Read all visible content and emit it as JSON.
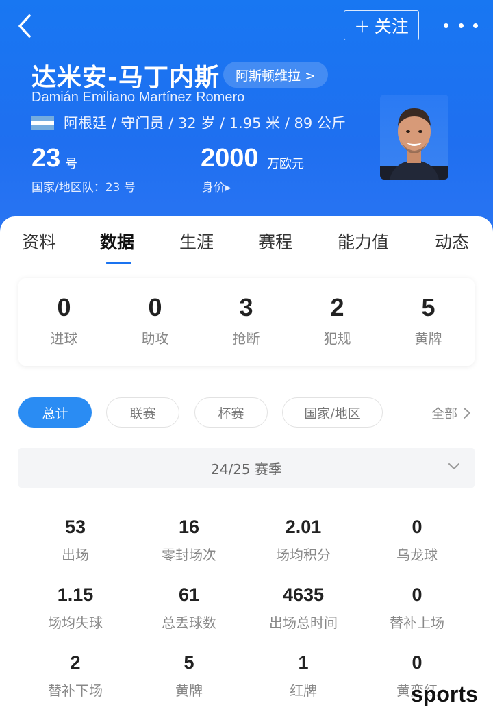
{
  "header": {
    "back_icon": "chevron-left-icon",
    "follow_label": "关注",
    "follow_plus": "+",
    "more_icon": "more-dots-icon",
    "name_cn": "达米安-马丁内斯",
    "club": "阿斯顿维拉 >",
    "name_en": "Damián Emiliano Martínez Romero",
    "nationality_flag": "argentina-flag-icon",
    "info": "阿根廷 / 守门员 / 32 岁 / 1.95 米 / 89 公斤",
    "shirt_number": "23",
    "shirt_unit": "号",
    "national_team": "国家/地区队：23 号",
    "market_value": "2000",
    "market_value_unit": "万欧元",
    "market_value_label": "身价▸",
    "colors": {
      "primary": "#1877f2"
    }
  },
  "tabs": [
    {
      "label": "资料",
      "active": false
    },
    {
      "label": "数据",
      "active": true
    },
    {
      "label": "生涯",
      "active": false
    },
    {
      "label": "赛程",
      "active": false
    },
    {
      "label": "能力值",
      "active": false
    },
    {
      "label": "动态",
      "active": false
    }
  ],
  "summary": [
    {
      "value": "0",
      "label": "进球"
    },
    {
      "value": "0",
      "label": "助攻"
    },
    {
      "value": "3",
      "label": "抢断"
    },
    {
      "value": "2",
      "label": "犯规"
    },
    {
      "value": "5",
      "label": "黄牌"
    }
  ],
  "filters": {
    "chips": [
      "总计",
      "联赛",
      "杯赛",
      "国家/地区"
    ],
    "active_index": 0,
    "all_label": "全部"
  },
  "season": {
    "label": "24/25 赛季"
  },
  "stats": [
    {
      "value": "53",
      "label": "出场"
    },
    {
      "value": "16",
      "label": "零封场次"
    },
    {
      "value": "2.01",
      "label": "场均积分"
    },
    {
      "value": "0",
      "label": "乌龙球"
    },
    {
      "value": "1.15",
      "label": "场均失球"
    },
    {
      "value": "61",
      "label": "总丢球数"
    },
    {
      "value": "4635",
      "label": "出场总时间"
    },
    {
      "value": "0",
      "label": "替补上场"
    },
    {
      "value": "2",
      "label": "替补下场"
    },
    {
      "value": "5",
      "label": "黄牌"
    },
    {
      "value": "1",
      "label": "红牌"
    },
    {
      "value": "0",
      "label": "黄变红"
    }
  ],
  "watermark": "sports"
}
